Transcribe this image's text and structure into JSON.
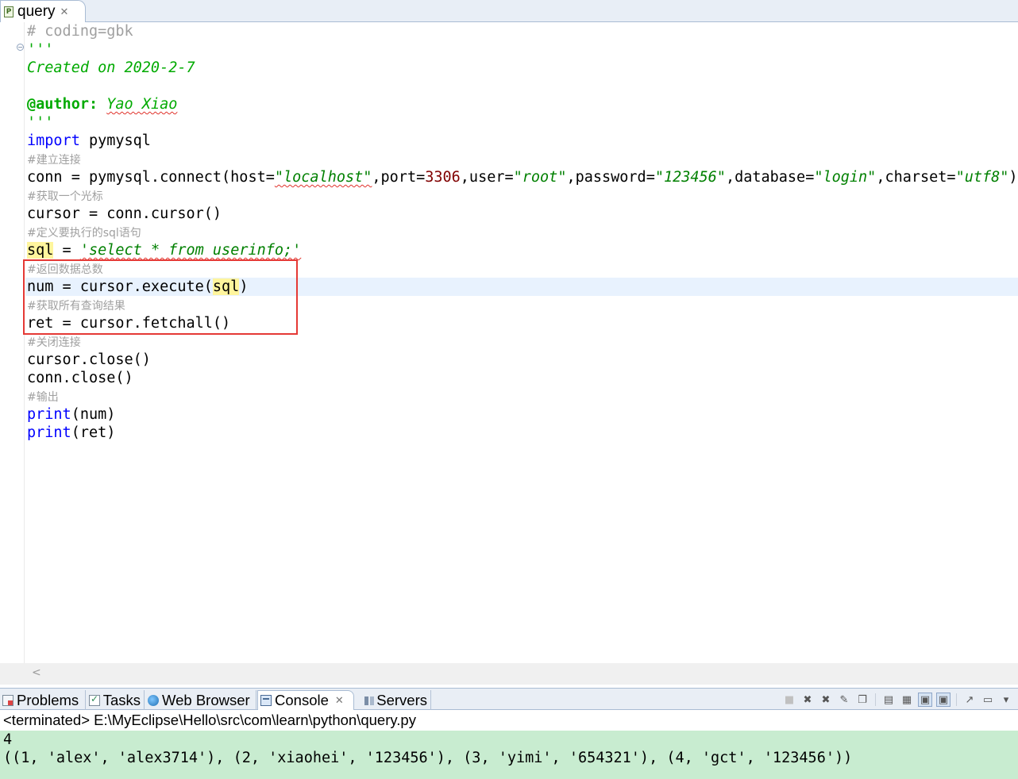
{
  "editor_tab": {
    "label": "query"
  },
  "code": {
    "line1": "# coding=gbk",
    "line2": "'''",
    "line3": "Created on 2020-2-7",
    "line4_key": "@author:",
    "line4_val": "Yao Xiao",
    "line5": "'''",
    "line6_kw": "import",
    "line6_rest": " pymysql",
    "c1": "#建立连接",
    "line8_a": "conn = pymysql.connect(host=",
    "line8_host": "\"localhost\"",
    "line8_b": ",port=",
    "line8_port": "3306",
    "line8_c": ",user=",
    "line8_user": "\"root\"",
    "line8_d": ",password=",
    "line8_pw": "\"123456\"",
    "line8_e": ",database=",
    "line8_db": "\"login\"",
    "line8_f": ",charset=",
    "line8_cs": "\"utf8\"",
    "line8_g": ")",
    "c2": "#获取一个光标",
    "line10": "cursor = conn.cursor()",
    "c3": "#定义要执行的sql语句",
    "line12_var": "sql",
    "line12_eq": " = ",
    "line12_str": "'select * from userinfo;'",
    "c4": "#返回数据总数",
    "line14_a": "num = cursor.execute(",
    "line14_var": "sql",
    "line14_b": ")",
    "c5": "#获取所有查询结果",
    "line16": "ret = cursor.fetchall()",
    "c6": "#关闭连接",
    "line18": "cursor.close()",
    "line19": "conn.close()",
    "c7": "#输出",
    "line21_kw": "print",
    "line21_rest": "(num)",
    "line22_kw": "print",
    "line22_rest": "(ret)"
  },
  "views": {
    "problems": "Problems",
    "tasks": "Tasks",
    "web_browser": "Web Browser",
    "console": "Console",
    "servers": "Servers"
  },
  "console": {
    "header": "<terminated> E:\\MyEclipse\\Hello\\src\\com\\learn\\python\\query.py",
    "output_line1": "4",
    "output_line2": "((1, 'alex', 'alex3714'), (2, 'xiaohei', '123456'), (3, 'yimi', '654321'), (4, 'gct', '123456'))"
  },
  "colors": {
    "keyword": "#0000ff",
    "string": "#008000",
    "number": "#800000",
    "comment": "#a0a0a0",
    "highlight_box": "#e53935",
    "console_bg": "#c8ecd0"
  },
  "icons": [
    "python-file-icon",
    "close-icon",
    "fold-icon",
    "problems-icon",
    "tasks-icon",
    "browser-icon",
    "console-icon",
    "servers-icon",
    "stop-icon",
    "remove-launch-icon",
    "remove-all-icon",
    "clear-console-icon",
    "scroll-lock-icon",
    "pin-console-icon",
    "display-console-icon",
    "scroll-left-icon"
  ]
}
